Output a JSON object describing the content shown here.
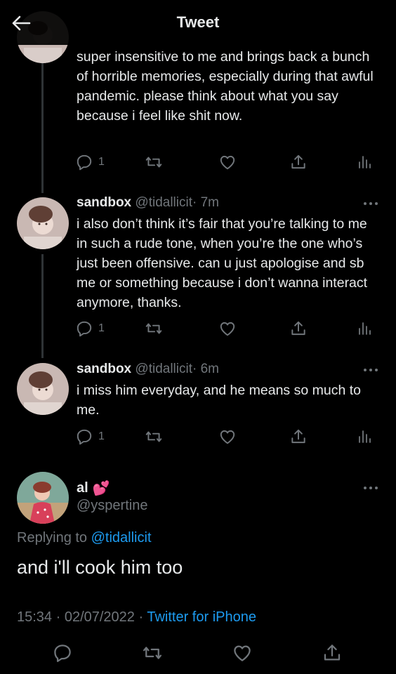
{
  "header": {
    "title": "Tweet"
  },
  "thread": [
    {
      "name": "",
      "handle": "",
      "time": "",
      "text": "super insensitive to me and brings back a bunch of horrible memories, especially during that awful pandemic. please think about what you say because i feel like shit now.",
      "reply_count": "1"
    },
    {
      "name": "sandbox",
      "handle": "@tidallicit",
      "time": "· 7m",
      "text": "i also don’t think it’s fair that you’re talking to me in such a rude tone, when you’re the one who’s just been offensive. can u just apologise and sb me or something because i don’t wanna interact anymore, thanks.",
      "reply_count": "1"
    },
    {
      "name": "sandbox",
      "handle": "@tidallicit",
      "time": "· 6m",
      "text": "i miss him everyday, and he means so much to me.",
      "reply_count": "1"
    }
  ],
  "main_tweet": {
    "name": "al",
    "emoji": "💕",
    "handle": "@yspertine",
    "replying_prefix": "Replying to",
    "replying_to": "@tidallicit",
    "text": "and i'll cook him too",
    "timestamp": "15:34 · 02/07/2022 ·",
    "source": "Twitter for iPhone"
  },
  "colors": {
    "background": "#000000",
    "text": "#e7e9ea",
    "muted": "#71767b",
    "accent": "#1d9bf0",
    "divider": "#2f3336"
  }
}
